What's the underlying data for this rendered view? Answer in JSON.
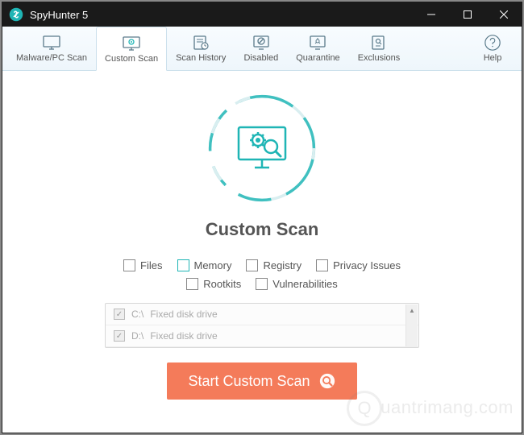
{
  "window": {
    "title": "SpyHunter 5"
  },
  "toolbar": {
    "items": [
      {
        "label": "Malware/PC Scan",
        "icon": "monitor"
      },
      {
        "label": "Custom Scan",
        "icon": "monitor-gear",
        "selected": true
      },
      {
        "label": "Scan History",
        "icon": "history"
      },
      {
        "label": "Disabled",
        "icon": "blocked"
      },
      {
        "label": "Quarantine",
        "icon": "quarantine"
      },
      {
        "label": "Exclusions",
        "icon": "exclusions"
      }
    ],
    "help_label": "Help"
  },
  "main": {
    "heading": "Custom Scan",
    "options_row1": [
      {
        "label": "Files"
      },
      {
        "label": "Memory",
        "highlighted": true
      },
      {
        "label": "Registry"
      },
      {
        "label": "Privacy Issues"
      }
    ],
    "options_row2": [
      {
        "label": "Rootkits"
      },
      {
        "label": "Vulnerabilities"
      }
    ],
    "drives": [
      {
        "letter": "C:\\",
        "desc": "Fixed disk drive"
      },
      {
        "letter": "D:\\",
        "desc": "Fixed disk drive"
      }
    ],
    "start_label": "Start Custom Scan"
  },
  "watermark": "uantrimang.com"
}
